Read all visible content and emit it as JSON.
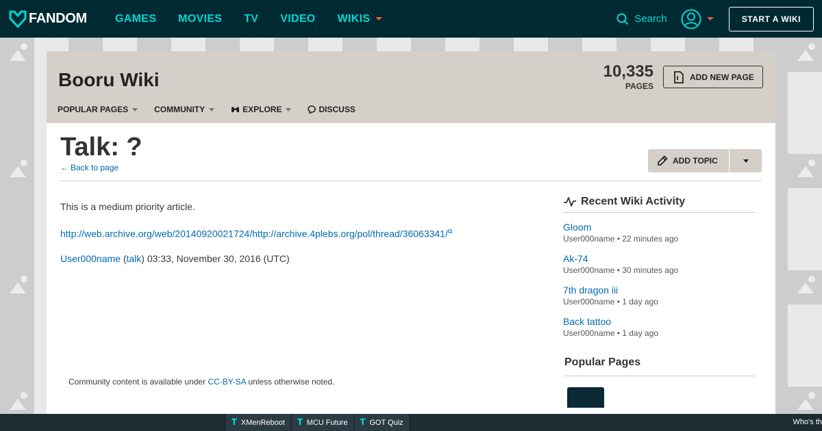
{
  "global_nav": {
    "logo": "FANDOM",
    "links": [
      {
        "label": "GAMES"
      },
      {
        "label": "MOVIES"
      },
      {
        "label": "TV"
      },
      {
        "label": "VIDEO"
      },
      {
        "label": "WIKIS"
      }
    ],
    "search_label": "Search",
    "start_wiki": "START A WIKI"
  },
  "wiki": {
    "title": "Booru Wiki",
    "page_count": "10,335",
    "page_count_label": "PAGES",
    "add_new_page": "ADD NEW PAGE",
    "local_nav": [
      {
        "label": "POPULAR PAGES"
      },
      {
        "label": "COMMUNITY"
      },
      {
        "label": "EXPLORE"
      },
      {
        "label": "DISCUSS"
      }
    ]
  },
  "page": {
    "title": "Talk: ?",
    "back_link": "Back to page",
    "add_topic": "ADD TOPIC",
    "paragraph1": "This is a medium priority article.",
    "url": "http://web.archive.org/web/20140920021724/http://archive.4plebs.org/pol/thread/36063341/",
    "signature_user": "User000name",
    "signature_open": " (",
    "signature_talk": "talk",
    "signature_rest": ") 03:33, November 30, 2016 (UTC)"
  },
  "rail": {
    "recent_title": "Recent Wiki Activity",
    "activity": [
      {
        "title": "Gloom",
        "meta": "User000name • 22 minutes ago"
      },
      {
        "title": "Ak-74",
        "meta": "User000name • 30 minutes ago"
      },
      {
        "title": "7th dragon iii",
        "meta": "User000name • 1 day ago"
      },
      {
        "title": "Back tattoo",
        "meta": "User000name • 1 day ago"
      }
    ],
    "popular_title": "Popular Pages"
  },
  "footer": {
    "prefix": "Community content is available under ",
    "license": "CC-BY-SA",
    "suffix": " unless otherwise noted."
  },
  "bottom_bar": {
    "tabs": [
      {
        "label": "XMenReboot"
      },
      {
        "label": "MCU Future"
      },
      {
        "label": "GOT Quiz"
      }
    ],
    "right_text": "Who's th"
  },
  "colors": {
    "nav_bg": "#002a32",
    "nav_link": "#00d6d6",
    "accent": "#f0553a",
    "header_bg": "#d4d0c9",
    "link": "#0069b3"
  }
}
